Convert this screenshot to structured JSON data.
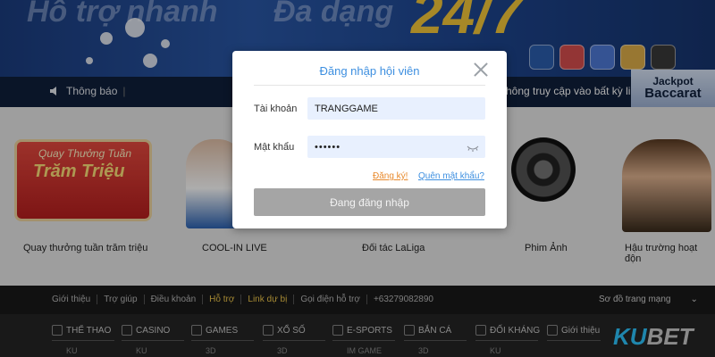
{
  "hero": {
    "notice_label": "Thông báo",
    "marquee_text": "hông truy cập vào bất kỳ lin",
    "jackpot_line1": "Jackpot",
    "jackpot_line2": "Baccarat",
    "big_text": "24/7"
  },
  "promos": [
    {
      "label": "Quay thưởng tuần trăm triệu",
      "banner_line1": "Quay Thưởng Tuần",
      "banner_line2": "Trăm Triệu"
    },
    {
      "label": "COOL-IN LIVE"
    },
    {
      "label": "Đối tác LaLiga"
    },
    {
      "label": "Phim Ảnh"
    },
    {
      "label": "Hậu trường hoạt độn"
    }
  ],
  "footer_nav": [
    "Giới thiệu",
    "Trợ giúp",
    "Điều khoản",
    "Hỗ trợ",
    "Link dự bị",
    "Gọi điện hỗ trợ",
    "+63279082890"
  ],
  "sitemap_label": "Sơ đồ trang mạng",
  "categories": [
    {
      "label": "THỂ THAO",
      "sub": "KU"
    },
    {
      "label": "CASINO",
      "sub": "KU"
    },
    {
      "label": "GAMES",
      "sub": "3D"
    },
    {
      "label": "XỔ SỐ",
      "sub": "3D"
    },
    {
      "label": "E-SPORTS",
      "sub": "IM GAME"
    },
    {
      "label": "BẮN CÁ",
      "sub": "3D"
    },
    {
      "label": "ĐỐI KHÁNG",
      "sub": "KU"
    },
    {
      "label": "Giới thiệu",
      "sub": ""
    }
  ],
  "logo": {
    "part1": "KU",
    "part2": "BET"
  },
  "modal": {
    "title": "Đăng nhập hội viên",
    "username_label": "Tài khoản",
    "username_value": "TRANGGAME",
    "password_label": "Mật khẩu",
    "password_value": "••••••",
    "register_link": "Đăng ký!",
    "forgot_link": "Quên mật khẩu?",
    "submit_label": "Đang đăng nhập"
  },
  "colors": {
    "modal_title": "#3d8fe0",
    "register_link": "#e8892b",
    "forgot_link": "#3d8fe0",
    "submit_disabled": "#a5a5a5",
    "input_bg": "#e8f0fe"
  }
}
